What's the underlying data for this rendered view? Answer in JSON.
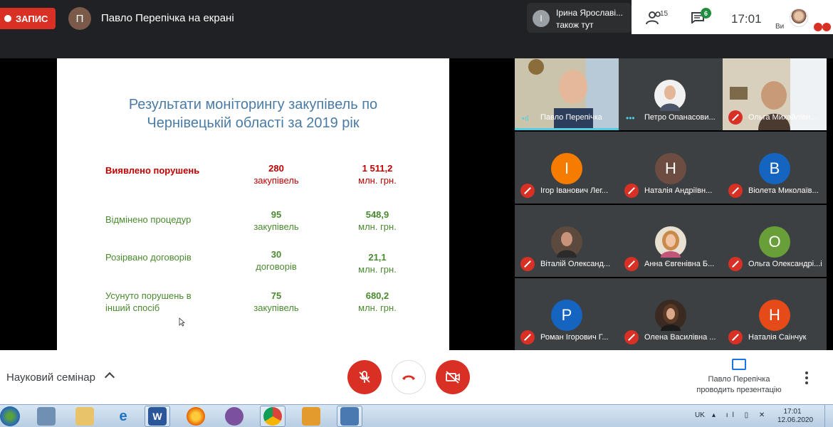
{
  "header": {
    "recording_label": "ЗАПИС",
    "presenter_initial": "П",
    "presenter_title": "Павло Перепічка на екрані",
    "also_here": {
      "initial": "І",
      "name": "Ірина Ярославі...",
      "subtitle": "також тут"
    },
    "people_count": "15",
    "chat_badge": "6",
    "time": "17:01",
    "self_label": "Ви"
  },
  "slide": {
    "title_line1": "Результати моніторингу закупівель по",
    "title_line2": "Чернівецькій області за 2019 рік",
    "rows": [
      {
        "label": "Виявлено порушень",
        "count": "280",
        "count_unit": "закупівель",
        "amount": "1 511,2",
        "amount_unit": "млн. грн."
      },
      {
        "label": "Відмінено процедур",
        "count": "95",
        "count_unit": "закупівель",
        "amount": "548,9",
        "amount_unit": "млн. грн."
      },
      {
        "label": "Розірвано договорів",
        "count": "30",
        "count_unit": "договорів",
        "amount": "21,1",
        "amount_unit": "млн. грн."
      },
      {
        "label_line1": "Усунуто порушень в",
        "label_line2": "інший спосіб",
        "count": "75",
        "count_unit": "закупівель",
        "amount": "680,2",
        "amount_unit": "млн. грн."
      }
    ]
  },
  "participants": [
    {
      "name": "Павло Перепічка",
      "type": "photo",
      "speaking": true
    },
    {
      "name": "Петро Опанасови...",
      "type": "photo"
    },
    {
      "name": "Ольга Михайлівн...",
      "type": "photo",
      "muted": true
    },
    {
      "name": "Ігор Іванович Лег...",
      "initial": "І",
      "color": "#f57c00",
      "muted": true
    },
    {
      "name": "Наталія Андріївн...",
      "initial": "Н",
      "color": "#6d4c41",
      "muted": true
    },
    {
      "name": "Віолета Миколаїв...",
      "initial": "В",
      "color": "#1565c0",
      "muted": true
    },
    {
      "name": "Віталій Олександ...",
      "type": "photo",
      "muted": true
    },
    {
      "name": "Анна Євгенівна Б...",
      "type": "photo",
      "muted": true
    },
    {
      "name": "Ольга Олександрі...і",
      "initial": "О",
      "color": "#689f38",
      "muted": true
    },
    {
      "name": "Роман Ігорович Г...",
      "initial": "Р",
      "color": "#1565c0",
      "muted": true
    },
    {
      "name": "Олена Василівна ...",
      "type": "photo",
      "muted": true
    },
    {
      "name": "Наталія Саінчук",
      "initial": "Н",
      "color": "#e64a19",
      "muted": true
    }
  ],
  "footer": {
    "meeting_name": "Науковий семінар",
    "presenter_line1": "Павло Перепічка",
    "presenter_line2": "проводить презентацію"
  },
  "taskbar": {
    "lang": "UK",
    "time": "17:01",
    "date": "12.06.2020",
    "word_label": "W"
  },
  "colors": {
    "red": "#d93025",
    "slide_red": "#c00000",
    "slide_green": "#4a8a2f",
    "slide_title": "#4a7ba6"
  }
}
